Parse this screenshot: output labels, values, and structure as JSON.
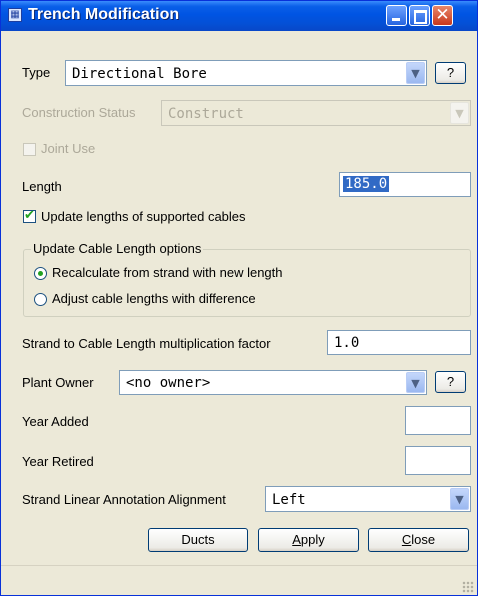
{
  "window": {
    "title": "Trench Modification",
    "controls": {
      "minimize": "minimize",
      "maximize": "maximize",
      "close": "close"
    }
  },
  "type": {
    "label": "Type",
    "value": "Directional Bore",
    "help": "?"
  },
  "construction_status": {
    "label": "Construction Status",
    "value": "Construct",
    "enabled": false
  },
  "joint_use": {
    "label": "Joint Use",
    "checked": false,
    "enabled": false
  },
  "length": {
    "label": "Length",
    "value": "185.0"
  },
  "update_lengths": {
    "label": "Update lengths of supported cables",
    "checked": true
  },
  "cable_length_options": {
    "group_label": "Update Cable Length options",
    "options": [
      {
        "label": "Recalculate from strand with new length",
        "selected": true
      },
      {
        "label": "Adjust cable lengths with difference",
        "selected": false
      }
    ]
  },
  "multiplication_factor": {
    "label": "Strand to Cable Length multiplication factor",
    "value": "1.0"
  },
  "plant_owner": {
    "label": "Plant Owner",
    "value": "<no owner>",
    "help": "?"
  },
  "year_added": {
    "label": "Year Added",
    "value": ""
  },
  "year_retired": {
    "label": "Year Retired",
    "value": ""
  },
  "annotation_alignment": {
    "label": "Strand Linear Annotation Alignment",
    "value": "Left"
  },
  "buttons": {
    "ducts": "Ducts",
    "apply_mnemonic": "A",
    "apply_rest": "pply",
    "close_mnemonic": "C",
    "close_rest": "lose"
  },
  "icons": {
    "dropdown": "chevron-down-icon",
    "checkmark": "checkmark-icon",
    "app": "window-icon"
  },
  "colors": {
    "titlebar": "#0054e3",
    "dialog_bg": "#ece9d8",
    "check_green": "#21a121",
    "selection": "#316ac5"
  }
}
